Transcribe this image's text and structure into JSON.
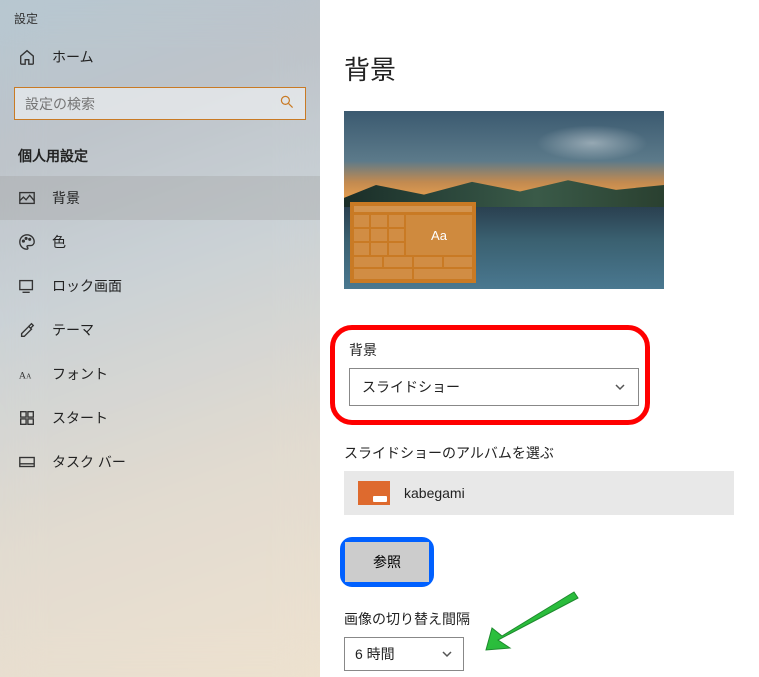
{
  "app": {
    "title": "設定"
  },
  "sidebar": {
    "home_label": "ホーム",
    "search": {
      "placeholder": "設定の検索"
    },
    "section": "個人用設定",
    "items": [
      {
        "label": "背景"
      },
      {
        "label": "色"
      },
      {
        "label": "ロック画面"
      },
      {
        "label": "テーマ"
      },
      {
        "label": "フォント"
      },
      {
        "label": "スタート"
      },
      {
        "label": "タスク バー"
      }
    ]
  },
  "main": {
    "title": "背景",
    "preview_sample_text": "Aa",
    "background": {
      "label": "背景",
      "value": "スライドショー"
    },
    "album": {
      "label": "スライドショーのアルバムを選ぶ",
      "folder_name": "kabegami",
      "browse_label": "参照"
    },
    "interval": {
      "label": "画像の切り替え間隔",
      "value": "6 時間"
    }
  }
}
